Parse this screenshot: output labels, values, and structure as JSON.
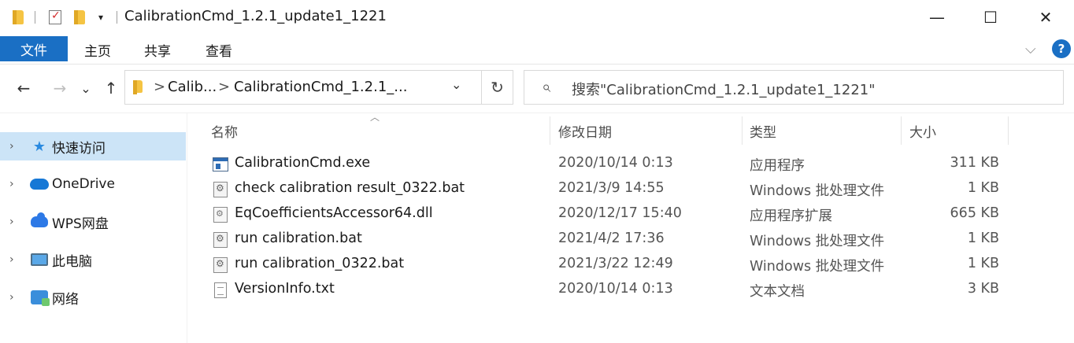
{
  "window": {
    "title": "CalibrationCmd_1.2.1_update1_1221",
    "minimize_glyph": "—",
    "maximize_glyph": "☐",
    "close_glyph": "✕"
  },
  "ribbon": {
    "tabs": [
      "文件",
      "主页",
      "共享",
      "查看"
    ]
  },
  "nav": {
    "back_glyph": "←",
    "forward_glyph": "→",
    "recent_glyph": "⌄",
    "up_glyph": "↑",
    "breadcrumb": [
      "Calib...",
      "CalibrationCmd_1.2.1_..."
    ],
    "crumb_sep": ">",
    "refresh_glyph": "↻",
    "search_placeholder": "搜索\"CalibrationCmd_1.2.1_update1_1221\""
  },
  "sidebar": {
    "items": [
      {
        "label": "快速访问",
        "icon": "star-icon",
        "selected": true
      },
      {
        "label": "OneDrive",
        "icon": "onedrive-cloud-icon",
        "selected": false
      },
      {
        "label": "WPS网盘",
        "icon": "wps-cloud-icon",
        "selected": false
      },
      {
        "label": "此电脑",
        "icon": "computer-icon",
        "selected": false
      },
      {
        "label": "网络",
        "icon": "network-icon",
        "selected": false
      }
    ]
  },
  "columns": {
    "name": "名称",
    "modified": "修改日期",
    "type": "类型",
    "size": "大小"
  },
  "files": [
    {
      "name": "CalibrationCmd.exe",
      "modified": "2020/10/14 0:13",
      "type": "应用程序",
      "size": "311 KB",
      "icon": "exe-icon"
    },
    {
      "name": "check calibration result_0322.bat",
      "modified": "2021/3/9 14:55",
      "type": "Windows 批处理文件",
      "size": "1 KB",
      "icon": "bat-icon"
    },
    {
      "name": "EqCoefficientsAccessor64.dll",
      "modified": "2020/12/17 15:40",
      "type": "应用程序扩展",
      "size": "665 KB",
      "icon": "dll-icon"
    },
    {
      "name": "run calibration.bat",
      "modified": "2021/4/2 17:36",
      "type": "Windows 批处理文件",
      "size": "1 KB",
      "icon": "bat-icon"
    },
    {
      "name": "run calibration_0322.bat",
      "modified": "2021/3/22 12:49",
      "type": "Windows 批处理文件",
      "size": "1 KB",
      "icon": "bat-icon"
    },
    {
      "name": "VersionInfo.txt",
      "modified": "2020/10/14 0:13",
      "type": "文本文档",
      "size": "3 KB",
      "icon": "txt-icon"
    }
  ],
  "colors": {
    "accent": "#1a6fc4",
    "selection": "#cce4f7"
  }
}
